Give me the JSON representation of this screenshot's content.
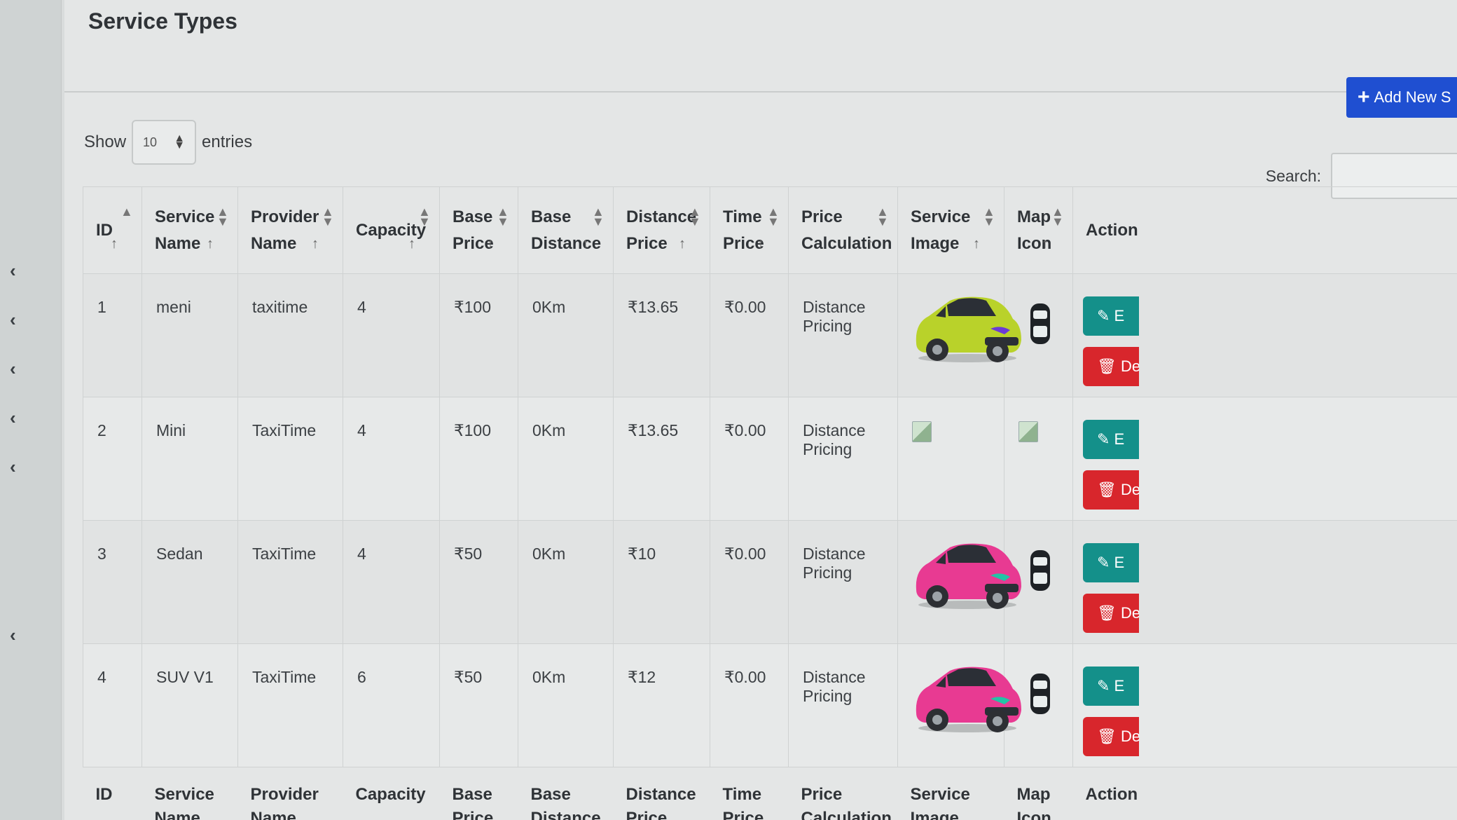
{
  "page": {
    "title": "Service Types",
    "add_button_label": "Add New S"
  },
  "table_controls": {
    "show_label": "Show",
    "entries_value": "10",
    "entries_label": "entries",
    "search_label": "Search:"
  },
  "columns": {
    "id": "ID",
    "service_name": "Service Name",
    "provider_name": "Provider Name",
    "capacity": "Capacity",
    "base_price": "Base Price",
    "base_distance": "Base Distance",
    "distance_price": "Distance Price",
    "time_price": "Time Price",
    "price_calculation": "Price Calculation",
    "service_image": "Service Image",
    "map_icon": "Map Icon",
    "action": "Action"
  },
  "rows": [
    {
      "id": "1",
      "service_name": "meni",
      "provider_name": "taxitime",
      "capacity": "4",
      "base_price": "₹100",
      "base_distance": "0Km",
      "distance_price": "₹13.65",
      "time_price": "₹0.00",
      "price_calculation": "Distance Pricing",
      "image": "car-yellow-green",
      "map_icon": "car-top-icon"
    },
    {
      "id": "2",
      "service_name": "Mini",
      "provider_name": "TaxiTime",
      "capacity": "4",
      "base_price": "₹100",
      "base_distance": "0Km",
      "distance_price": "₹13.65",
      "time_price": "₹0.00",
      "price_calculation": "Distance Pricing",
      "image": "broken-image-icon",
      "map_icon": "broken-image-icon"
    },
    {
      "id": "3",
      "service_name": "Sedan",
      "provider_name": "TaxiTime",
      "capacity": "4",
      "base_price": "₹50",
      "base_distance": "0Km",
      "distance_price": "₹10",
      "time_price": "₹0.00",
      "price_calculation": "Distance Pricing",
      "image": "car-pink",
      "map_icon": "car-top-icon"
    },
    {
      "id": "4",
      "service_name": "SUV V1",
      "provider_name": "TaxiTime",
      "capacity": "6",
      "base_price": "₹50",
      "base_distance": "0Km",
      "distance_price": "₹12",
      "time_price": "₹0.00",
      "price_calculation": "Distance Pricing",
      "image": "car-pink",
      "map_icon": "car-top-icon"
    }
  ],
  "actions": {
    "edit_label": "E",
    "delete_label": "De"
  },
  "colors": {
    "car_yellow_green": "#b9d22a",
    "car_pink": "#e83a92",
    "edit": "#14908a",
    "delete": "#d8262c",
    "add": "#1f4fd1"
  }
}
